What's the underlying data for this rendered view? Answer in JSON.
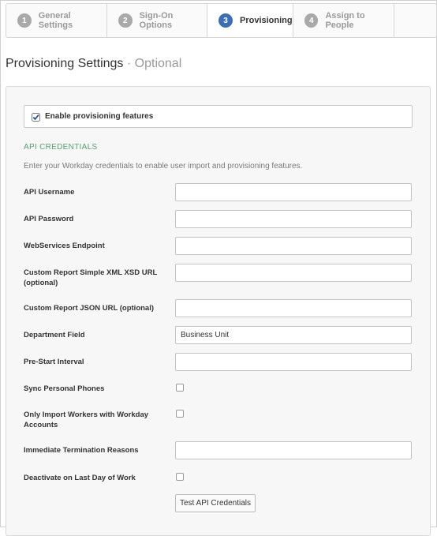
{
  "wizard": {
    "steps": [
      {
        "number": "1",
        "label": "General Settings"
      },
      {
        "number": "2",
        "label": "Sign-On Options"
      },
      {
        "number": "3",
        "label": "Provisioning"
      },
      {
        "number": "4",
        "label": "Assign to People"
      }
    ],
    "active_step": 3
  },
  "page": {
    "title": "Provisioning Settings",
    "title_suffix": "· Optional"
  },
  "enable": {
    "label": "Enable provisioning features",
    "checked": true
  },
  "api": {
    "section_title": "API CREDENTIALS",
    "description": "Enter your Workday credentials to enable user import and provisioning features."
  },
  "fields": {
    "api_username": {
      "label": "API Username",
      "value": ""
    },
    "api_password": {
      "label": "API Password",
      "value": ""
    },
    "webservices_endpoint": {
      "label": "WebServices Endpoint",
      "value": ""
    },
    "custom_report_xsd": {
      "label": "Custom Report Simple XML XSD URL (optional)",
      "value": ""
    },
    "custom_report_json": {
      "label": "Custom Report JSON URL (optional)",
      "value": ""
    },
    "department_field": {
      "label": "Department Field",
      "value": "Business Unit"
    },
    "pre_start_interval": {
      "label": "Pre-Start Interval",
      "value": ""
    },
    "sync_personal_phones": {
      "label": "Sync Personal Phones",
      "checked": false
    },
    "only_import_workers": {
      "label": "Only Import Workers with Workday Accounts",
      "checked": false
    },
    "immediate_termination": {
      "label": "Immediate Termination Reasons",
      "value": ""
    },
    "deactivate_last_day": {
      "label": "Deactivate on Last Day of Work",
      "checked": false
    }
  },
  "test_button": {
    "label": "Test API Credentials"
  },
  "colors": {
    "accent": "#3a6fb5",
    "section": "#5a9e6f"
  }
}
